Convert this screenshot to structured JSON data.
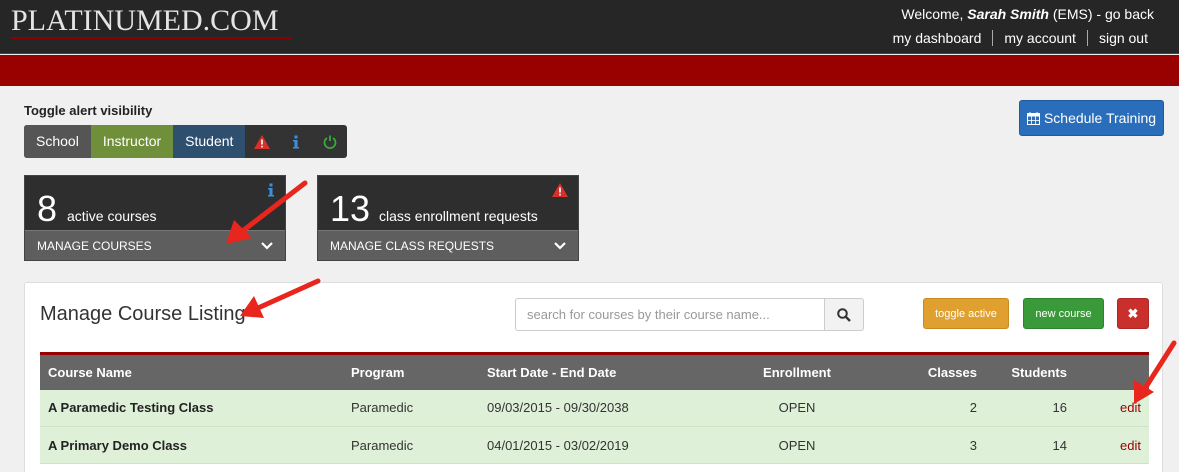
{
  "header": {
    "logo": "PLATINUMED.COM",
    "welcome_prefix": "Welcome,",
    "user_name": "Sarah Smith",
    "user_role": "(EMS)",
    "go_back": "- go back",
    "links": [
      "my dashboard",
      "my account",
      "sign out"
    ]
  },
  "alerts": {
    "title": "Toggle alert visibility",
    "school": "School",
    "instructor": "Instructor",
    "student": "Student",
    "icons": [
      "warning-icon",
      "info-icon",
      "power-icon"
    ]
  },
  "schedule_button": "Schedule Training",
  "stats": [
    {
      "number": "8",
      "label": "active courses",
      "footer": "MANAGE COURSES",
      "icon": "info-icon"
    },
    {
      "number": "13",
      "label": "class enrollment requests",
      "footer": "MANAGE CLASS REQUESTS",
      "icon": "warning-icon"
    }
  ],
  "panel": {
    "title": "Manage Course Listing",
    "search_placeholder": "search for courses by their course name...",
    "toggle_active": "toggle active",
    "new_course": "new course",
    "delete_symbol": "✖"
  },
  "table": {
    "headers": [
      "Course Name",
      "Program",
      "Start Date - End Date",
      "Enrollment",
      "Classes",
      "Students",
      ""
    ],
    "rows": [
      {
        "name": "A Paramedic Testing Class",
        "program": "Paramedic",
        "dates": "09/03/2015 - 09/30/2038",
        "enrollment": "OPEN",
        "classes": "2",
        "students": "16",
        "action": "edit"
      },
      {
        "name": "A Primary Demo Class",
        "program": "Paramedic",
        "dates": "04/01/2015 - 03/02/2019",
        "enrollment": "OPEN",
        "classes": "3",
        "students": "14",
        "action": "edit"
      }
    ]
  },
  "colors": {
    "brand_red": "#990000",
    "header_bg": "#262626",
    "instructor_green": "#6f8f3a",
    "student_blue": "#2f4f6f",
    "row_green": "#dff0d8",
    "arrow_red": "#e8261e"
  }
}
